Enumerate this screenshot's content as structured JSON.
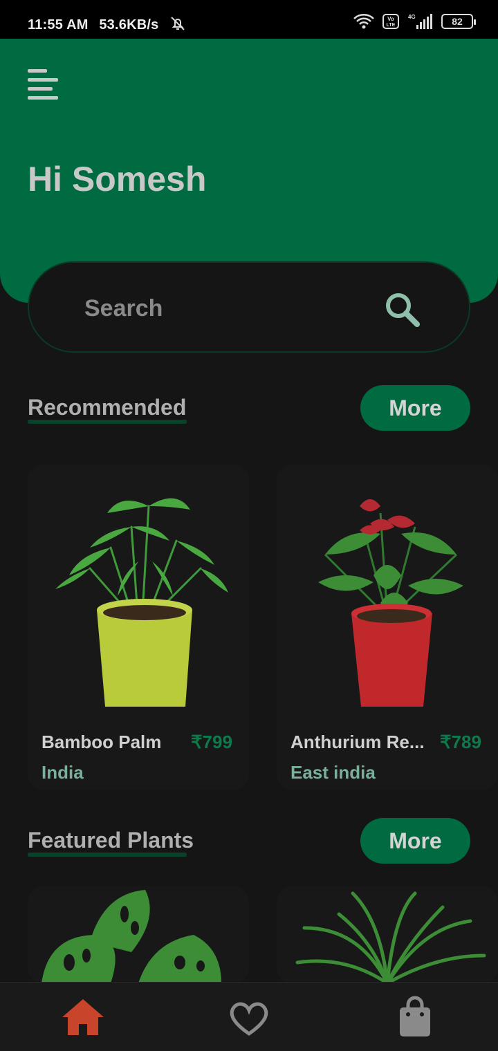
{
  "status": {
    "time": "11:55 AM",
    "speed": "53.6KB/s",
    "network": "4G",
    "volte": "Vo LTE",
    "battery": "82"
  },
  "header": {
    "greeting": "Hi Somesh"
  },
  "search": {
    "placeholder": "Search"
  },
  "recommended": {
    "title": "Recommended",
    "more_label": "More",
    "items": [
      {
        "name": "Bamboo Palm",
        "price": "₹799",
        "origin": "India"
      },
      {
        "name": "Anthurium Re...",
        "price": "₹789",
        "origin": "East india"
      }
    ]
  },
  "featured": {
    "title": "Featured Plants",
    "more_label": "More"
  },
  "nav": {
    "items": [
      "home-icon",
      "heart-icon",
      "shopping-bag-icon"
    ],
    "active_color": "#c8452c"
  },
  "colors": {
    "brand_green": "#006a40",
    "background": "#151515"
  }
}
